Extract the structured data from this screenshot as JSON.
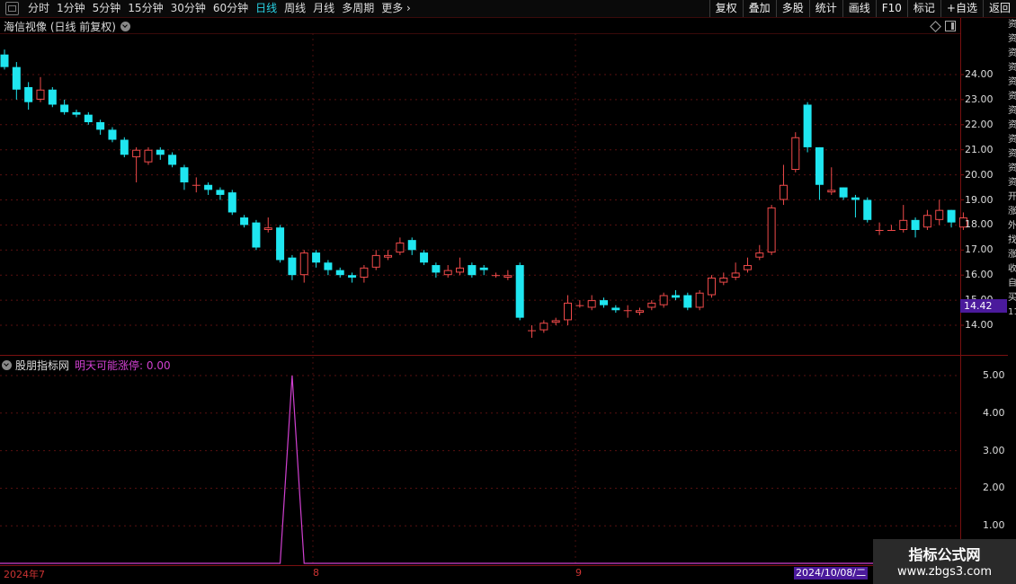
{
  "toolbar": {
    "periods": [
      "分时",
      "1分钟",
      "5分钟",
      "15分钟",
      "30分钟",
      "60分钟",
      "日线",
      "周线",
      "月线",
      "多周期",
      "更多"
    ],
    "active_period": "日线",
    "right_tools": [
      "复权",
      "叠加",
      "多股",
      "统计",
      "画线",
      "F10",
      "标记",
      "+自选",
      "返回"
    ]
  },
  "main_chart": {
    "title": "海信视像 (日线 前复权)",
    "price_label": "14.42",
    "y_ticks": [
      "24.00",
      "23.00",
      "22.00",
      "21.00",
      "20.00",
      "19.00",
      "18.00",
      "17.00",
      "16.00",
      "15.00",
      "14.00"
    ],
    "up_color": "#f04a4a",
    "down_color": "#1fe6f0"
  },
  "indicator": {
    "name": "股朋指标网",
    "label": "明天可能涨停: 0.00",
    "y_ticks": [
      "5.00",
      "4.00",
      "3.00",
      "2.00",
      "1.00"
    ],
    "color": "#d040d0"
  },
  "x_axis": {
    "ticks": [
      "2024年7",
      "8",
      "9"
    ],
    "cursor_date": "2024/10/08/二"
  },
  "right_edge_text": "资资资资资资资资资资资资开涨外找涨收自买1111111",
  "watermark": {
    "title": "指标公式网",
    "url": "www.zbgs3.com"
  },
  "chart_data": {
    "type": "candlestick",
    "title": "",
    "ylim": [
      13.5,
      24.5
    ],
    "candles": [
      [
        24.8,
        24.3,
        25.0,
        24.2
      ],
      [
        24.3,
        23.4,
        24.5,
        23.0
      ],
      [
        23.5,
        22.9,
        23.7,
        22.6
      ],
      [
        23.0,
        23.4,
        23.9,
        22.9
      ],
      [
        23.4,
        22.8,
        23.5,
        22.7
      ],
      [
        22.8,
        22.5,
        23.0,
        22.4
      ],
      [
        22.5,
        22.4,
        22.6,
        22.3
      ],
      [
        22.4,
        22.1,
        22.5,
        22.0
      ],
      [
        22.1,
        21.8,
        22.2,
        21.6
      ],
      [
        21.8,
        21.4,
        21.9,
        21.3
      ],
      [
        21.4,
        20.8,
        21.5,
        20.7
      ],
      [
        20.7,
        21.0,
        21.1,
        19.7
      ],
      [
        20.5,
        21.0,
        21.1,
        20.4
      ],
      [
        21.0,
        20.8,
        21.1,
        20.6
      ],
      [
        20.8,
        20.4,
        20.9,
        20.3
      ],
      [
        20.3,
        19.7,
        20.4,
        19.4
      ],
      [
        19.6,
        19.6,
        19.9,
        19.3
      ],
      [
        19.6,
        19.4,
        19.7,
        19.2
      ],
      [
        19.4,
        19.2,
        19.5,
        19.0
      ],
      [
        19.3,
        18.5,
        19.4,
        18.4
      ],
      [
        18.3,
        18.0,
        18.4,
        17.9
      ],
      [
        18.1,
        17.1,
        18.2,
        17.0
      ],
      [
        17.8,
        17.9,
        18.3,
        17.7
      ],
      [
        17.9,
        16.6,
        18.0,
        16.5
      ],
      [
        16.7,
        16.0,
        16.8,
        15.8
      ],
      [
        16.0,
        16.9,
        17.0,
        15.7
      ],
      [
        16.9,
        16.5,
        17.0,
        16.3
      ],
      [
        16.5,
        16.2,
        16.6,
        16.0
      ],
      [
        16.2,
        16.0,
        16.3,
        15.9
      ],
      [
        16.0,
        15.9,
        16.1,
        15.7
      ],
      [
        15.9,
        16.3,
        16.4,
        15.7
      ],
      [
        16.3,
        16.8,
        17.0,
        16.2
      ],
      [
        16.7,
        16.8,
        17.0,
        16.6
      ],
      [
        16.9,
        17.3,
        17.5,
        16.8
      ],
      [
        17.4,
        17.0,
        17.5,
        16.8
      ],
      [
        16.9,
        16.5,
        17.0,
        16.4
      ],
      [
        16.4,
        16.1,
        16.5,
        15.9
      ],
      [
        16.0,
        16.2,
        16.4,
        15.9
      ],
      [
        16.1,
        16.3,
        16.7,
        16.0
      ],
      [
        16.4,
        16.0,
        16.5,
        15.9
      ],
      [
        16.3,
        16.2,
        16.4,
        16.0
      ],
      [
        16.0,
        16.0,
        16.1,
        15.9
      ],
      [
        15.9,
        16.0,
        16.2,
        15.8
      ],
      [
        16.4,
        14.3,
        16.5,
        14.2
      ],
      [
        13.8,
        13.8,
        14.0,
        13.5
      ],
      [
        13.8,
        14.1,
        14.2,
        13.7
      ],
      [
        14.1,
        14.2,
        14.3,
        14.0
      ],
      [
        14.2,
        14.9,
        15.2,
        14.0
      ],
      [
        14.8,
        14.8,
        15.0,
        14.7
      ],
      [
        14.7,
        15.0,
        15.2,
        14.6
      ],
      [
        15.0,
        14.8,
        15.1,
        14.7
      ],
      [
        14.7,
        14.6,
        14.8,
        14.5
      ],
      [
        14.6,
        14.6,
        14.8,
        14.3
      ],
      [
        14.5,
        14.6,
        14.7,
        14.4
      ],
      [
        14.7,
        14.9,
        15.0,
        14.6
      ],
      [
        14.8,
        15.2,
        15.3,
        14.7
      ],
      [
        15.2,
        15.1,
        15.4,
        15.0
      ],
      [
        15.2,
        14.7,
        15.3,
        14.6
      ],
      [
        14.7,
        15.3,
        15.4,
        14.6
      ],
      [
        15.2,
        15.9,
        16.0,
        15.1
      ],
      [
        15.7,
        15.9,
        16.1,
        15.6
      ],
      [
        15.9,
        16.1,
        16.5,
        15.8
      ],
      [
        16.2,
        16.4,
        16.7,
        16.1
      ],
      [
        16.7,
        16.9,
        17.2,
        16.6
      ],
      [
        16.9,
        18.7,
        18.8,
        16.8
      ],
      [
        19.0,
        19.6,
        20.4,
        18.8
      ],
      [
        20.2,
        21.5,
        21.7,
        20.1
      ],
      [
        22.8,
        21.1,
        22.9,
        20.9
      ],
      [
        21.1,
        19.6,
        21.1,
        19.0
      ],
      [
        19.3,
        19.4,
        20.3,
        19.2
      ],
      [
        19.5,
        19.1,
        19.5,
        19.0
      ],
      [
        19.1,
        19.0,
        19.2,
        18.3
      ],
      [
        19.0,
        18.2,
        19.1,
        18.1
      ],
      [
        17.8,
        17.8,
        18.1,
        17.6
      ],
      [
        17.8,
        17.8,
        18.0,
        17.8
      ],
      [
        17.8,
        18.2,
        18.8,
        17.7
      ],
      [
        18.2,
        17.8,
        18.3,
        17.5
      ],
      [
        17.9,
        18.4,
        18.6,
        17.8
      ],
      [
        18.2,
        18.6,
        19.0,
        18.0
      ],
      [
        18.6,
        18.1,
        18.6,
        17.9
      ],
      [
        17.9,
        18.3,
        18.5,
        17.8
      ]
    ],
    "indicator_series": {
      "name": "明天可能涨停",
      "ylim": [
        0,
        5.5
      ],
      "spike_index": 24,
      "spike_value": 5.0
    },
    "x_ticks": [
      "2024年7",
      "8",
      "9"
    ]
  }
}
